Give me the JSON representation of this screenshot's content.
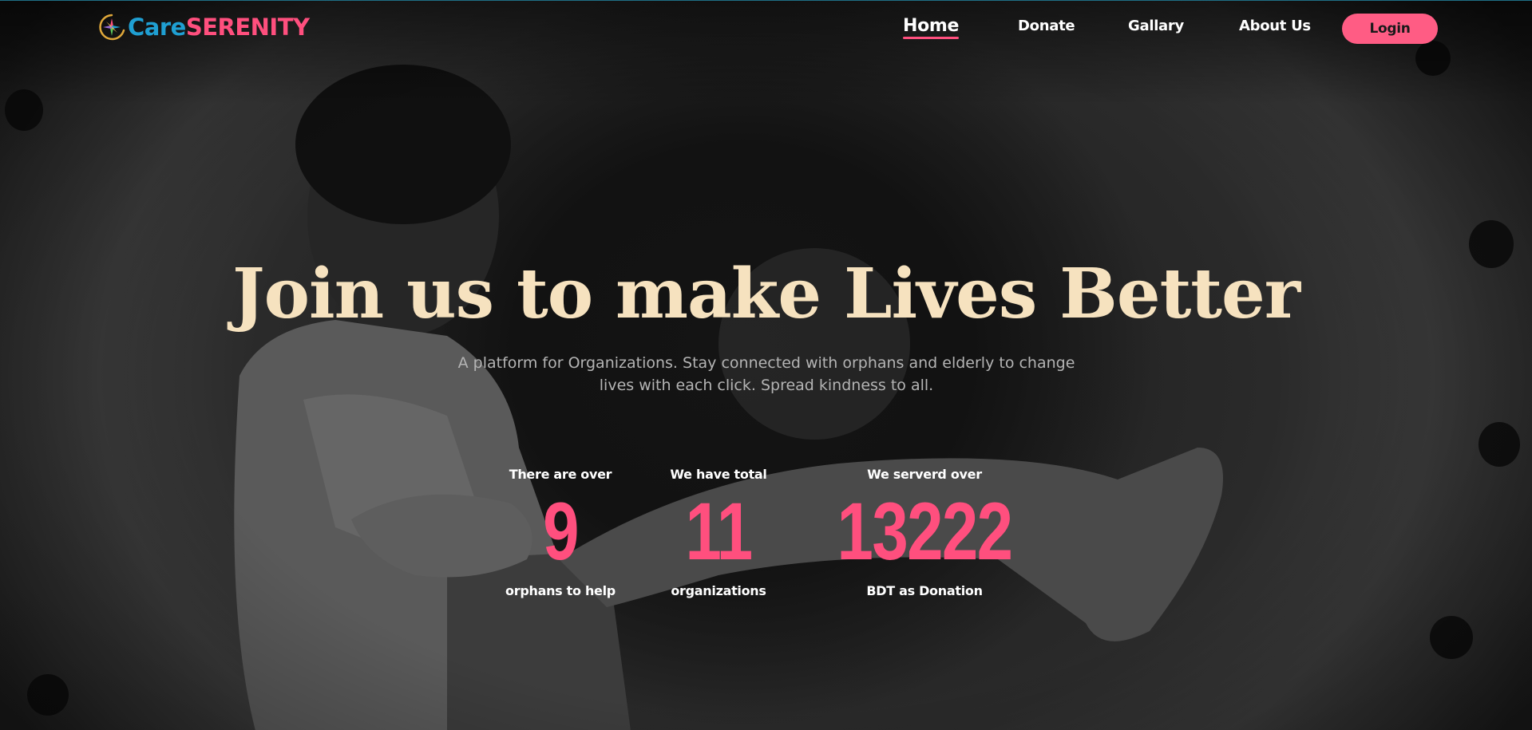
{
  "brand": {
    "name_part1": "Care",
    "name_part2": "SERENITY",
    "color_part1": "#1f9fd2",
    "color_part2": "#ff4f7e",
    "icon": "compass-logo-icon"
  },
  "nav": {
    "items": [
      {
        "label": "Home",
        "active": true
      },
      {
        "label": "Donate",
        "active": false
      },
      {
        "label": "Gallary",
        "active": false
      },
      {
        "label": "About Us",
        "active": false
      }
    ],
    "login_label": "Login",
    "accent_color": "#ff5c84"
  },
  "hero": {
    "title": "Join us to make Lives Better",
    "subtitle_line1": "A platform for Organizations. Stay connected with orphans and elderly to change",
    "subtitle_line2": "lives with each click. Spread kindness to all.",
    "title_color": "#f6e2bf"
  },
  "stats": [
    {
      "pre": "There are over",
      "value": "9",
      "post": "orphans to help"
    },
    {
      "pre": "We have total",
      "value": "11",
      "post": "organizations"
    },
    {
      "pre": "We serverd over",
      "value": "13222",
      "post": "BDT as Donation"
    }
  ]
}
